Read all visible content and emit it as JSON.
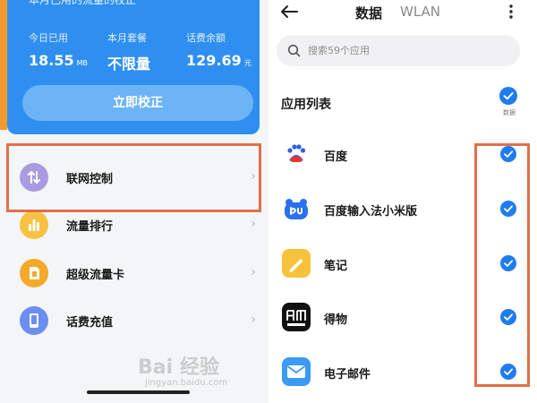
{
  "left_panel": {
    "card": {
      "note": "本月已用的流量的校正",
      "stats": [
        {
          "label": "今日已用",
          "value": "18.55",
          "unit": "MB"
        },
        {
          "label": "本月套餐",
          "value": "不限量",
          "unit": ""
        },
        {
          "label": "话费余额",
          "value": "129.69",
          "unit": "元"
        }
      ],
      "calibrate_label": "立即校正",
      "colors": {
        "card": "#2f8ff0",
        "button": "#6cb4f5",
        "edge": "#f29a2e"
      }
    },
    "menu": [
      {
        "label": "联网控制",
        "icon": "network-control-icon",
        "color": "#a99be0"
      },
      {
        "label": "流量排行",
        "icon": "traffic-ranking-icon",
        "color": "#f7c244"
      },
      {
        "label": "超级流量卡",
        "icon": "super-data-card-icon",
        "color": "#f6a829"
      },
      {
        "label": "话费充值",
        "icon": "phone-topup-icon",
        "color": "#6b8ef0"
      }
    ],
    "chevron": "›",
    "highlight_color": "#e0704a"
  },
  "right_panel": {
    "tabs": [
      {
        "label": "数据",
        "active": true
      },
      {
        "label": "WLAN",
        "active": false
      }
    ],
    "search": {
      "placeholder": "搜索59个应用",
      "value": ""
    },
    "list_header": "应用列表",
    "select_all_caption": "数据",
    "apps": [
      {
        "name": "百度",
        "icon": "baidu-icon",
        "checked": true
      },
      {
        "name": "百度输入法小米版",
        "icon": "baidu-input-icon",
        "checked": true
      },
      {
        "name": "笔记",
        "icon": "notes-icon",
        "checked": true
      },
      {
        "name": "得物",
        "icon": "dewu-icon",
        "checked": true
      },
      {
        "name": "电子邮件",
        "icon": "email-icon",
        "checked": true
      }
    ],
    "check_color": "#1f7cf0"
  },
  "watermark": {
    "logo": "Bai 经验",
    "url": "jingyan.baidu.com"
  }
}
